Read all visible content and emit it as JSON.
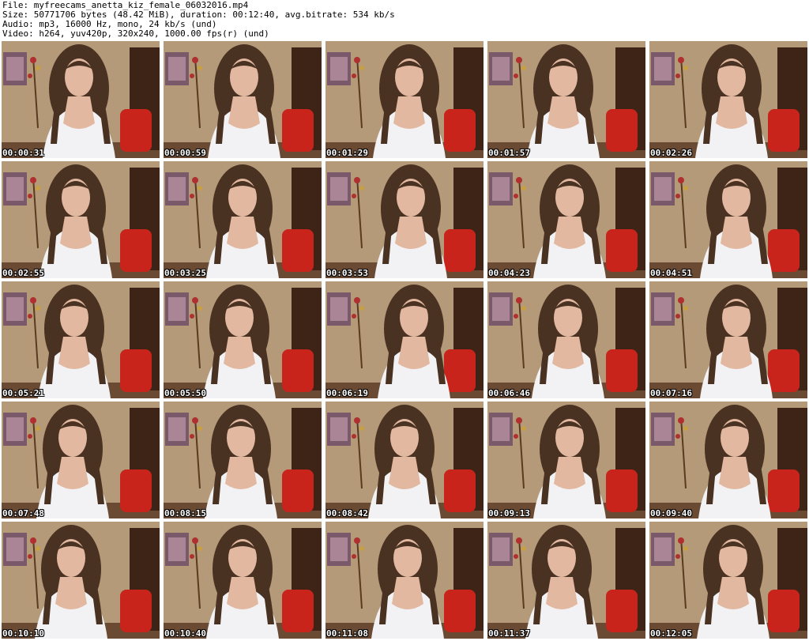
{
  "header": {
    "file": "File: myfreecams_anetta_kiz_female_06032016.mp4",
    "size": "Size: 50771706 bytes (48.42 MiB), duration: 00:12:40, avg.bitrate: 534 kb/s",
    "audio": "Audio: mp3, 16000 Hz, mono, 24 kb/s (und)",
    "video": "Video: h264, yuv420p, 320x240, 1000.00 fps(r) (und)"
  },
  "thumbnails": [
    {
      "timestamp": "00:00:31"
    },
    {
      "timestamp": "00:00:59"
    },
    {
      "timestamp": "00:01:29"
    },
    {
      "timestamp": "00:01:57"
    },
    {
      "timestamp": "00:02:26"
    },
    {
      "timestamp": "00:02:55"
    },
    {
      "timestamp": "00:03:25"
    },
    {
      "timestamp": "00:03:53"
    },
    {
      "timestamp": "00:04:23"
    },
    {
      "timestamp": "00:04:51"
    },
    {
      "timestamp": "00:05:21"
    },
    {
      "timestamp": "00:05:50"
    },
    {
      "timestamp": "00:06:19"
    },
    {
      "timestamp": "00:06:46"
    },
    {
      "timestamp": "00:07:16"
    },
    {
      "timestamp": "00:07:48"
    },
    {
      "timestamp": "00:08:15"
    },
    {
      "timestamp": "00:08:42"
    },
    {
      "timestamp": "00:09:13"
    },
    {
      "timestamp": "00:09:40"
    },
    {
      "timestamp": "00:10:10"
    },
    {
      "timestamp": "00:10:40"
    },
    {
      "timestamp": "00:11:08"
    },
    {
      "timestamp": "00:11:37"
    },
    {
      "timestamp": "00:12:05"
    }
  ],
  "colors": {
    "wall": "#b49a78",
    "door": "#3e2416",
    "chair": "#c8241c",
    "hair": "#4a3222",
    "skin": "#e2b8a0",
    "top": "#f2f2f4",
    "floor": "#6a4a32",
    "painting": "#7a5a6a"
  }
}
